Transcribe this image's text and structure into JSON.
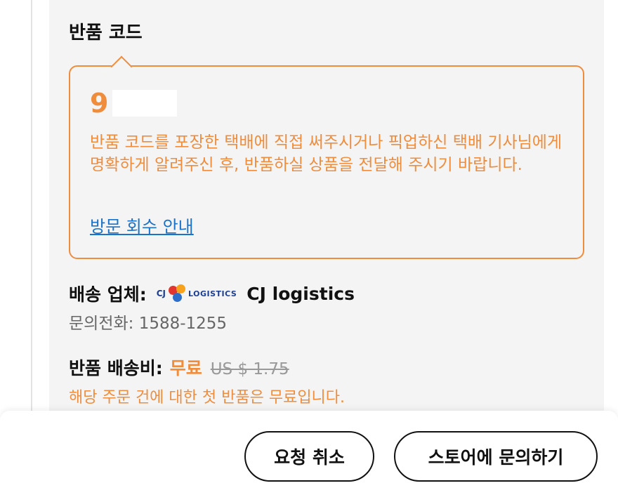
{
  "return_code": {
    "section_title": "반품 코드",
    "code_value": "9",
    "instruction": "반품 코드를 포장한 택배에 직접 써주시거나 픽업하신 택배 기사님에게 명확하게 알려주신 후, 반품하실 상품을 전달해 주시기 바랍니다.",
    "visit_link": "방문 회수 안내"
  },
  "carrier": {
    "label": "배송 업체:",
    "logo_text_cj": "CJ",
    "logo_text_logistics": "LOGISTICS",
    "name": "CJ logistics",
    "phone": "문의전화: 1588-1255"
  },
  "shipping_fee": {
    "label": "반품 배송비:",
    "free_label": "무료",
    "original_price": "US $ 1.75",
    "note": "해당 주문 건에 대한 첫 반품은 무료입니다."
  },
  "actions": {
    "cancel_request": "요청 취소",
    "contact_store": "스토어에 문의하기"
  },
  "colors": {
    "accent_orange": "#ef8d3d",
    "link_blue": "#1a73c9",
    "panel_bg": "#f4f4f4"
  }
}
